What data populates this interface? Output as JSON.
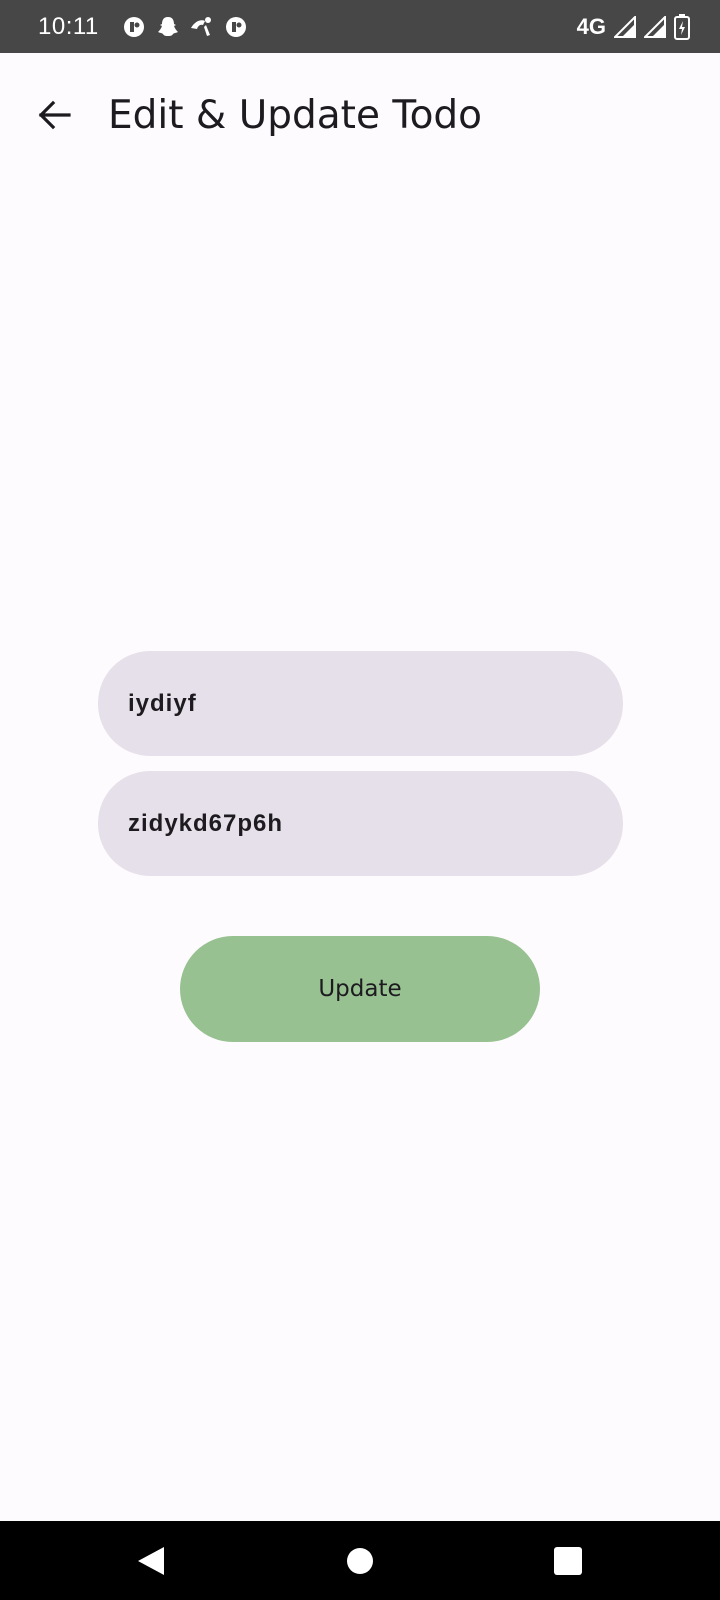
{
  "status_bar": {
    "time": "10:11",
    "network": "4G",
    "left_icons": [
      "notification-app-icon",
      "snapchat-icon",
      "phone-icon",
      "notification-app-icon"
    ],
    "right_icons": [
      "signal-icon",
      "signal-icon",
      "battery-charging-icon"
    ]
  },
  "app_bar": {
    "title": "Edit & Update Todo",
    "back_icon": "arrow-left-icon"
  },
  "form": {
    "title_value": "iydiyf",
    "description_value": "zidykd67p6h",
    "update_label": "Update"
  },
  "nav_bar": {
    "icons": [
      "back-triangle-icon",
      "home-circle-icon",
      "recents-square-icon"
    ]
  },
  "colors": {
    "status_bar_bg": "#474747",
    "background": "#fefbfe",
    "field_bg": "#e6e0ea",
    "button_bg": "#97c190",
    "text": "#1d1b20"
  }
}
